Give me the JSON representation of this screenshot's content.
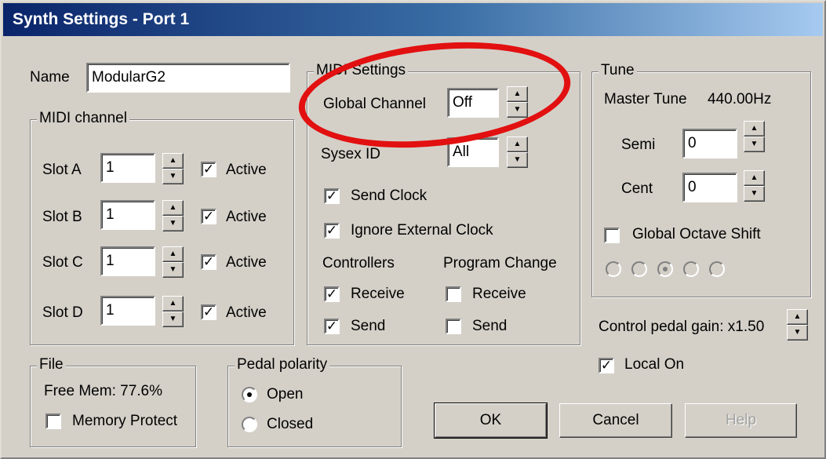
{
  "title": "Synth Settings - Port 1",
  "name": {
    "label": "Name",
    "value": "ModularG2"
  },
  "midi_channel": {
    "legend": "MIDI channel",
    "slots": [
      {
        "label": "Slot A",
        "value": "1",
        "active_label": "Active",
        "checked": true
      },
      {
        "label": "Slot B",
        "value": "1",
        "active_label": "Active",
        "checked": true
      },
      {
        "label": "Slot C",
        "value": "1",
        "active_label": "Active",
        "checked": true
      },
      {
        "label": "Slot D",
        "value": "1",
        "active_label": "Active",
        "checked": true
      }
    ]
  },
  "midi_settings": {
    "legend": "MIDI Settings",
    "global_channel_label": "Global Channel",
    "global_channel_value": "Off",
    "sysex_label": "Sysex ID",
    "sysex_value": "All",
    "send_clock_label": "Send Clock",
    "ignore_clock_label": "Ignore External Clock",
    "controllers_label": "Controllers",
    "program_change_label": "Program Change",
    "receive_label": "Receive",
    "send_label": "Send"
  },
  "tune": {
    "legend": "Tune",
    "master_label": "Master Tune",
    "master_value": "440.00Hz",
    "semi_label": "Semi",
    "semi_value": "0",
    "cent_label": "Cent",
    "cent_value": "0",
    "octave_label": "Global Octave Shift"
  },
  "control_pedal": "Control pedal gain: x1.50",
  "local_on_label": "Local On",
  "file": {
    "legend": "File",
    "free_mem": "Free Mem: 77.6%",
    "memory_protect_label": "Memory Protect"
  },
  "pedal": {
    "legend": "Pedal polarity",
    "open_label": "Open",
    "closed_label": "Closed"
  },
  "buttons": {
    "ok": "OK",
    "cancel": "Cancel",
    "help": "Help"
  },
  "colors": {
    "accent": "#0a246a",
    "annotation": "#e21010",
    "face": "#d4d0c8"
  }
}
